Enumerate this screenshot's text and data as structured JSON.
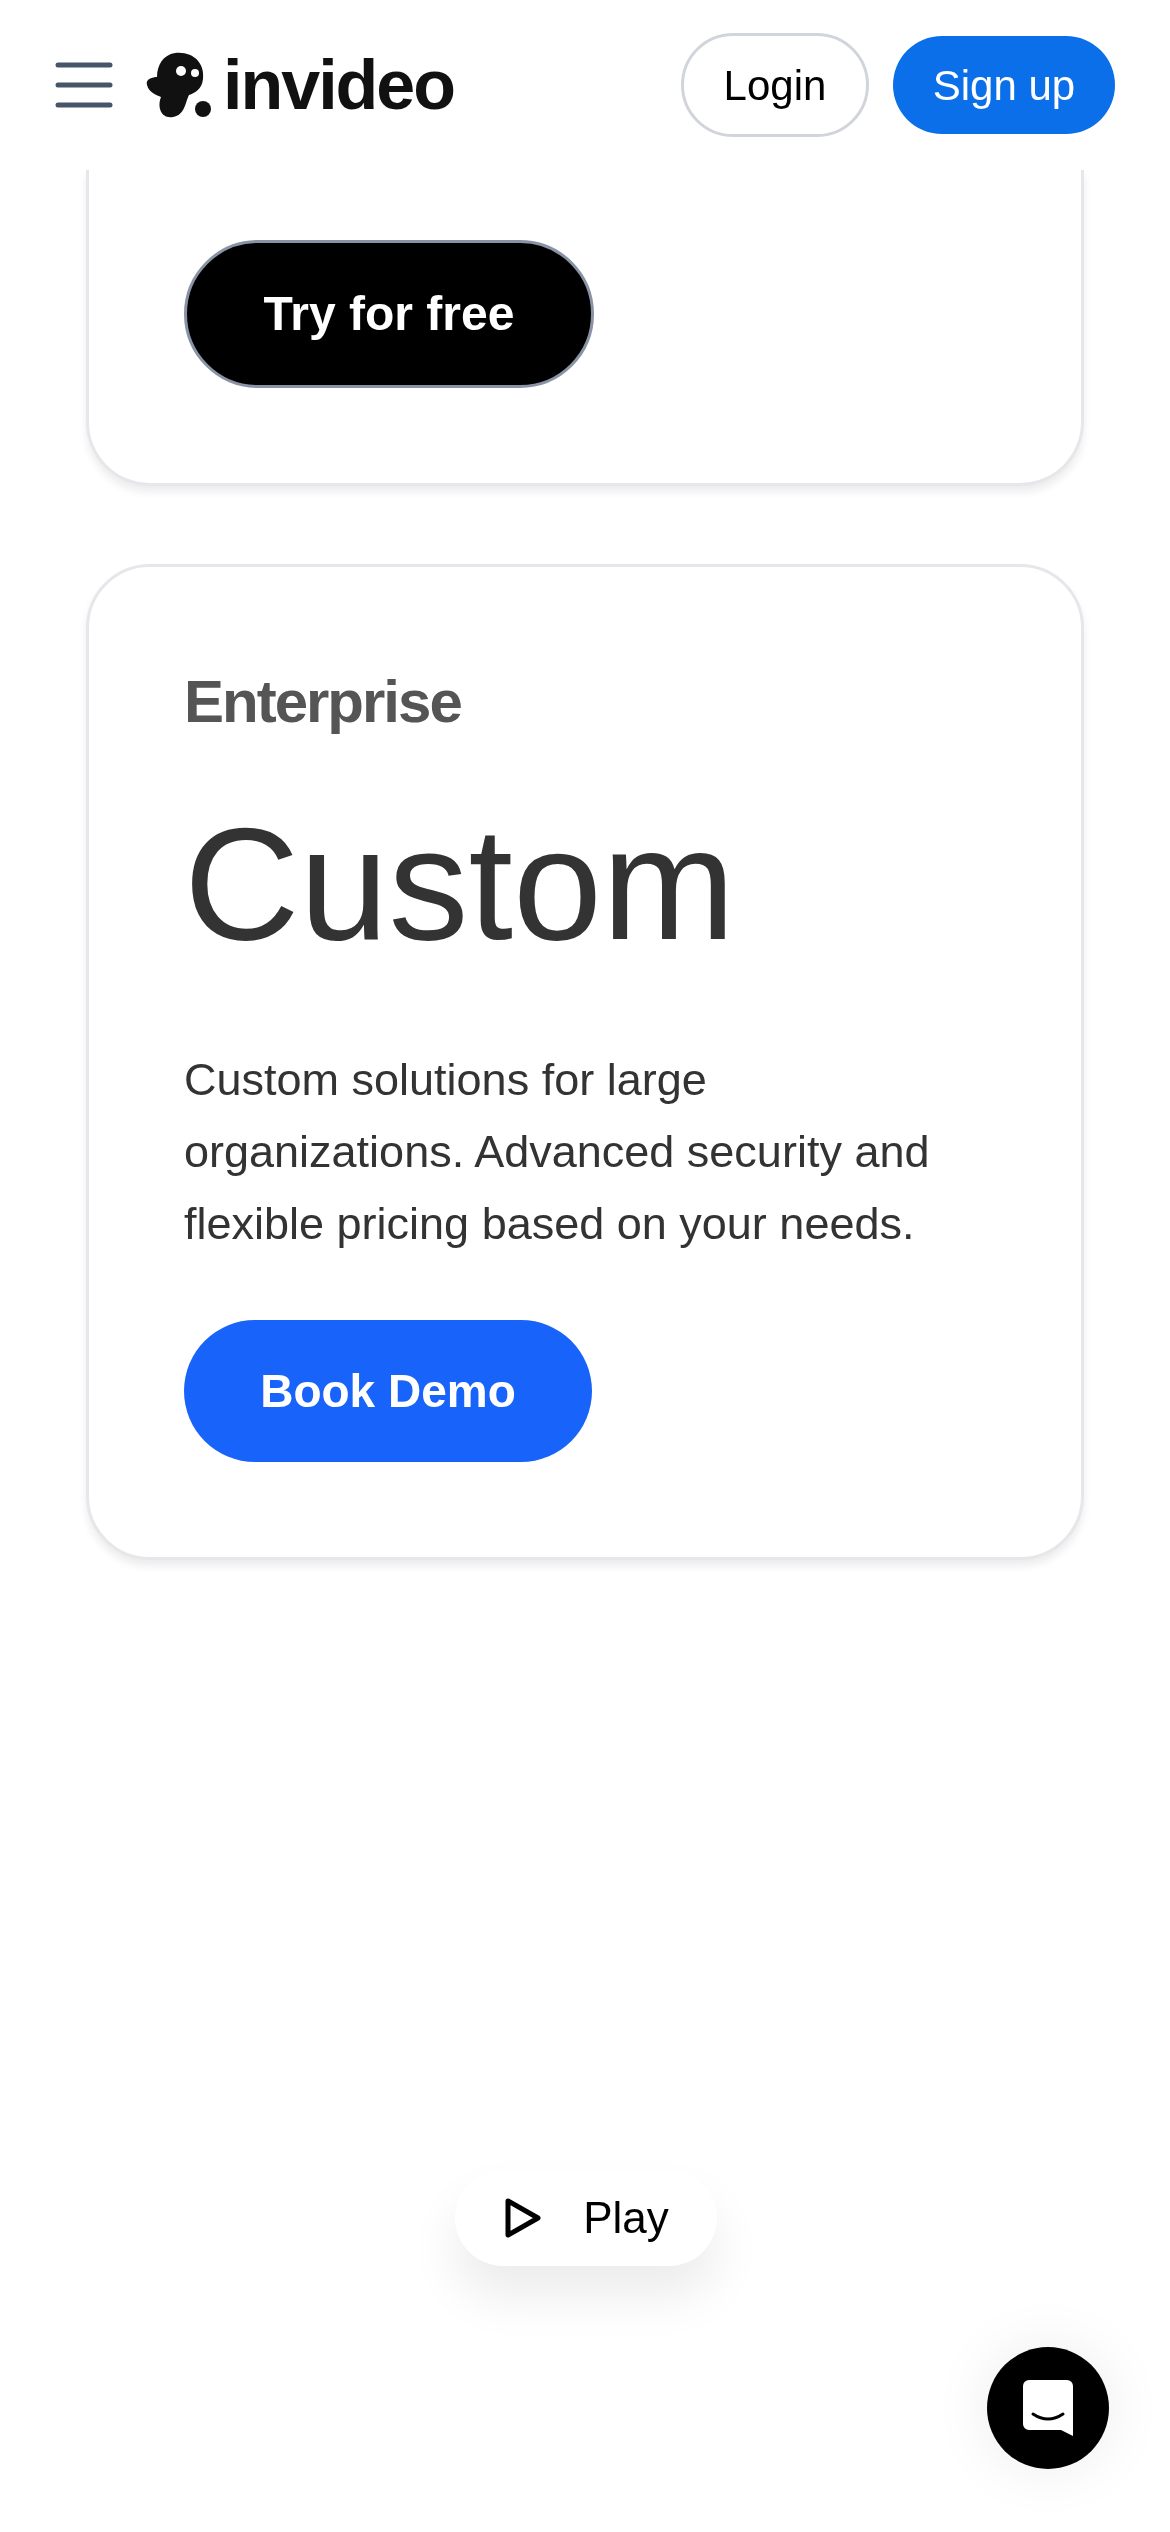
{
  "header": {
    "logo": "invideo",
    "login": "Login",
    "signup": "Sign up"
  },
  "plans": [
    {
      "kind": "cut",
      "button": "Try for free"
    },
    {
      "kind": "full",
      "tier": "Enterprise",
      "price": "Custom",
      "description": "Custom solutions for large organizations. Advanced security and flexible pricing based on your needs.",
      "button": "Book Demo"
    }
  ],
  "play": {
    "label": "Play"
  }
}
